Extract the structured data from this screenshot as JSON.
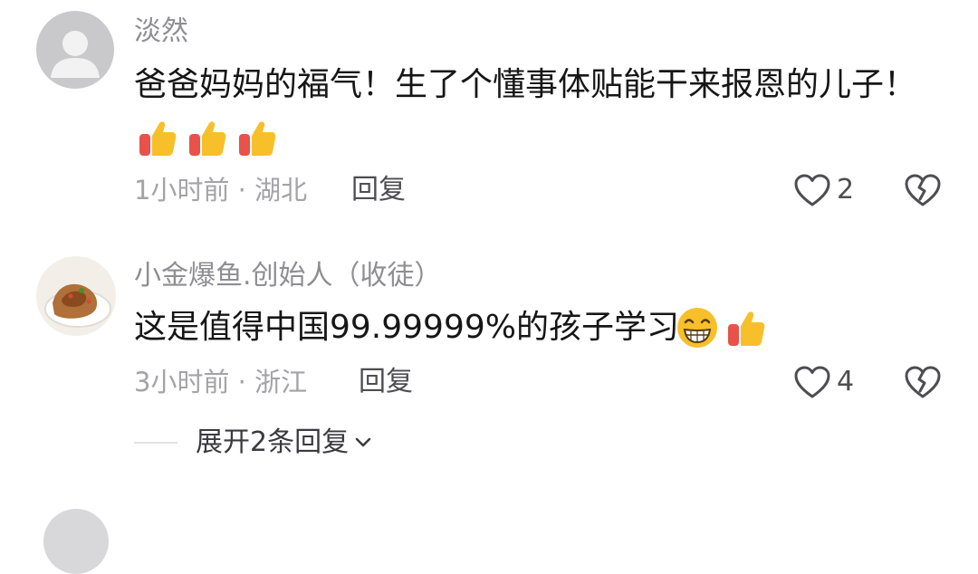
{
  "comments": [
    {
      "username": "淡然",
      "text": "爸爸妈妈的福气！生了个懂事体贴能干来报恩的儿子！",
      "emojis": [
        "thumbs-up-icon",
        "thumbs-up-icon",
        "thumbs-up-icon"
      ],
      "meta": "1小时前 · 湖北",
      "reply_label": "回复",
      "like_count": "2"
    },
    {
      "username": "小金爆鱼.创始人（收徒）",
      "text": "这是值得中国99.99999%的孩子学习",
      "emojis": [
        "grinning-face-icon",
        "thumbs-up-icon"
      ],
      "meta": "3小时前 · 浙江",
      "reply_label": "回复",
      "like_count": "4"
    }
  ],
  "expand_replies_label": "展开2条回复",
  "colors": {
    "meta_gray": "#a3a3a8",
    "text": "#161616",
    "emoji_yellow": "#f7c02b",
    "emoji_red": "#e8524a"
  }
}
